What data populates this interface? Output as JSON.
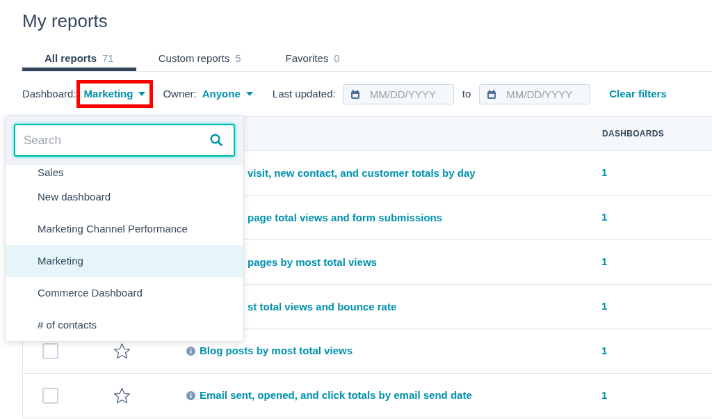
{
  "title": "My reports",
  "tabs": [
    {
      "label": "All reports",
      "count": "71",
      "selected": true
    },
    {
      "label": "Custom reports",
      "count": "5",
      "selected": false
    },
    {
      "label": "Favorites",
      "count": "0",
      "selected": false
    }
  ],
  "filters": {
    "dashboard_label": "Dashboard:",
    "dashboard_value": "Marketing",
    "dashboard_highlighted": true,
    "owner_label": "Owner:",
    "owner_value": "Anyone",
    "updated_label": "Last updated:",
    "from_placeholder": "MM/DD/YYYY",
    "to_label": "to",
    "to_placeholder": "MM/DD/YYYY",
    "clear": "Clear filters"
  },
  "table": {
    "columns": [
      "DASHBOARDS"
    ],
    "rows": [
      {
        "kind": "partial",
        "title": "visit, new contact, and customer totals by day",
        "dashboards": "1"
      },
      {
        "kind": "partial",
        "title": "page total views and form submissions",
        "dashboards": "1"
      },
      {
        "kind": "partial",
        "title": "pages by most total views",
        "dashboards": "1"
      },
      {
        "kind": "partial",
        "title": "st total views and bounce rate",
        "dashboards": "1"
      },
      {
        "kind": "full",
        "checked": false,
        "starred": false,
        "title": "Blog posts by most total views",
        "dashboards": "1"
      },
      {
        "kind": "full",
        "checked": false,
        "starred": false,
        "title": "Email sent, opened, and click totals by email send date",
        "dashboards": "1"
      }
    ]
  },
  "dropdown": {
    "search_placeholder": "Search",
    "items": [
      {
        "label": "Sales",
        "selected": false
      },
      {
        "label": "New dashboard",
        "selected": false
      },
      {
        "label": "Marketing Channel Performance",
        "selected": false
      },
      {
        "label": "Marketing",
        "selected": true
      },
      {
        "label": "Commerce Dashboard",
        "selected": false
      },
      {
        "label": "# of contacts",
        "selected": false
      }
    ]
  }
}
